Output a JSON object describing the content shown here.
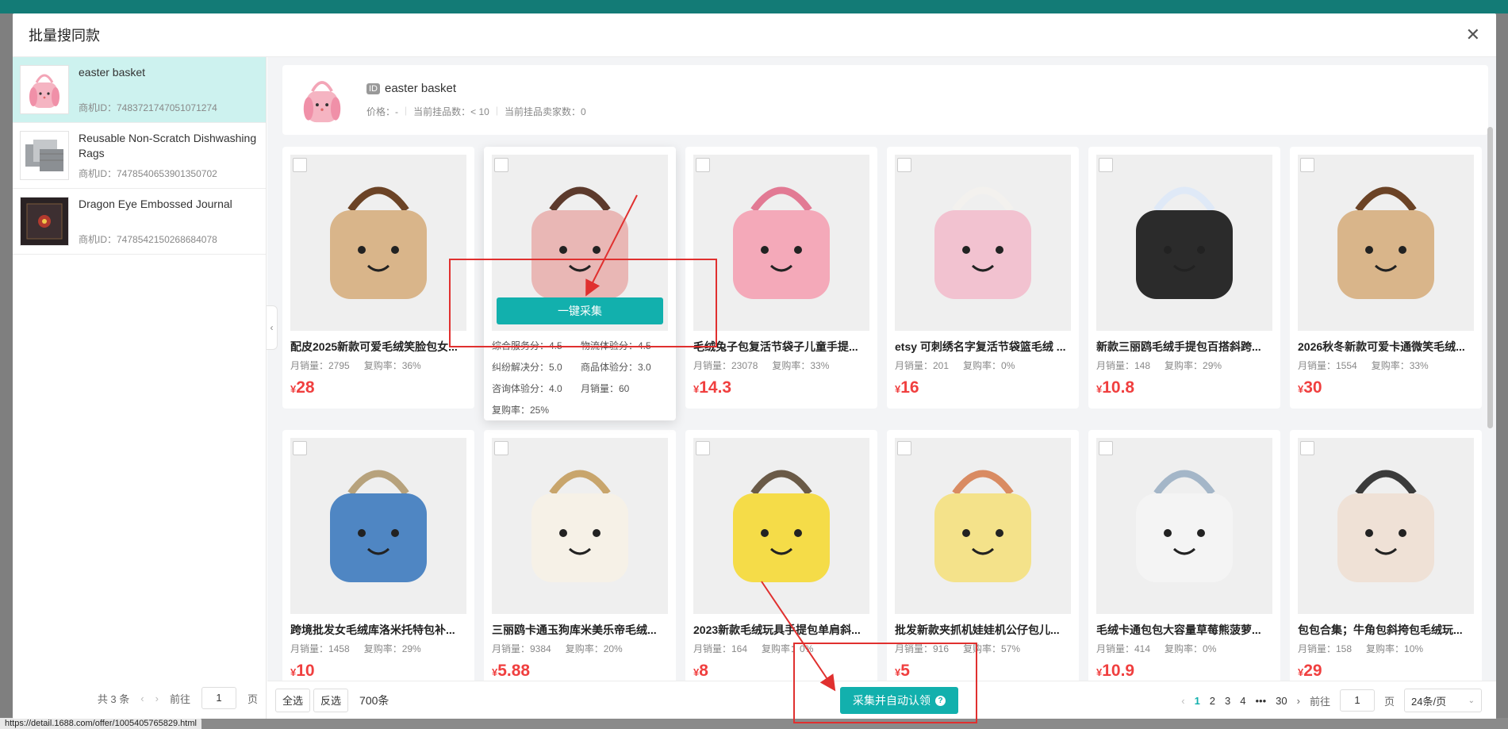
{
  "modal": {
    "title": "批量搜同款",
    "close_icon": "close-icon"
  },
  "left": {
    "items": [
      {
        "title": "easter basket",
        "id_label": "商机ID：7483721747051071274",
        "thumb": "pink-bunny-bag"
      },
      {
        "title": "Reusable Non-Scratch Dishwashing Rags",
        "id_label": "商机ID：7478540653901350702",
        "thumb": "gray-rags"
      },
      {
        "title": "Dragon Eye Embossed Journal",
        "id_label": "商机ID：7478542150268684078",
        "thumb": "dark-journal"
      }
    ],
    "pager": {
      "total": "共 3 条",
      "goto": "前往",
      "page": "1",
      "unit": "页"
    }
  },
  "header": {
    "id_tag": "ID",
    "title": "easter basket",
    "price": "价格：-",
    "listings": "当前挂品数：< 10",
    "sellers": "当前挂品卖家数：0"
  },
  "hover_card": {
    "button": "一键采集",
    "stats": [
      "综合服务分：4.5",
      "物流体验分：4.5",
      "纠纷解决分：5.0",
      "商品体验分：3.0",
      "咨询体验分：4.0",
      "月销量：60",
      "复购率：25%"
    ]
  },
  "products": [
    {
      "title": "配皮2025新款可爱毛绒笑脸包女...",
      "sales": "月销量：2795",
      "repurchase": "复购率：36%",
      "yen": "¥",
      "price": "28",
      "color": "#d9b58a",
      "accent": "#6b4326"
    },
    {
      "title": "",
      "sales": "",
      "repurchase": "",
      "yen": "",
      "price": "",
      "color": "#e9b7b5",
      "accent": "#5c3a2c"
    },
    {
      "title": "毛绒兔子包复活节袋子儿童手提...",
      "sales": "月销量：23078",
      "repurchase": "复购率：33%",
      "yen": "¥",
      "price": "14.3",
      "color": "#f4a9b9",
      "accent": "#e27a94"
    },
    {
      "title": "etsy 可刺绣名字复活节袋篮毛绒 ...",
      "sales": "月销量：201",
      "repurchase": "复购率：0%",
      "yen": "¥",
      "price": "16",
      "color": "#f2c2d0",
      "accent": "#f3f1ee"
    },
    {
      "title": "新款三丽鸥毛绒手提包百搭斜跨...",
      "sales": "月销量：148",
      "repurchase": "复购率：29%",
      "yen": "¥",
      "price": "10.8",
      "color": "#2b2b2b",
      "accent": "#dfe9f7"
    },
    {
      "title": "2026秋冬新款可爱卡通微笑毛绒...",
      "sales": "月销量：1554",
      "repurchase": "复购率：33%",
      "yen": "¥",
      "price": "30",
      "color": "#d9b58a",
      "accent": "#6b4326"
    },
    {
      "title": "跨境批发女毛绒库洛米托特包补...",
      "sales": "月销量：1458",
      "repurchase": "复购率：29%",
      "yen": "¥",
      "price": "10",
      "color": "#4f86c3",
      "accent": "#b7a27c"
    },
    {
      "title": "三丽鸥卡通玉狗库米美乐帝毛绒...",
      "sales": "月销量：9384",
      "repurchase": "复购率：20%",
      "yen": "¥",
      "price": "5.88",
      "color": "#f6f1e7",
      "accent": "#c8a56c"
    },
    {
      "title": "2023新款毛绒玩具手提包单肩斜...",
      "sales": "月销量：164",
      "repurchase": "复购率：0%",
      "yen": "¥",
      "price": "8",
      "color": "#f5dc48",
      "accent": "#6a5a47"
    },
    {
      "title": "批发新款夹抓机娃娃机公仔包儿...",
      "sales": "月销量：916",
      "repurchase": "复购率：57%",
      "yen": "¥",
      "price": "5",
      "color": "#f4e28a",
      "accent": "#d98b62"
    },
    {
      "title": "毛绒卡通包包大容量草莓熊菠萝...",
      "sales": "月销量：414",
      "repurchase": "复购率：0%",
      "yen": "¥",
      "price": "10.9",
      "color": "#f4f4f4",
      "accent": "#a4b6c8"
    },
    {
      "title": "包包合集；牛角包斜挎包毛绒玩...",
      "sales": "月销量：158",
      "repurchase": "复购率：10%",
      "yen": "¥",
      "price": "29",
      "color": "#efe1d6",
      "accent": "#3b3b3b"
    }
  ],
  "footer": {
    "select_all": "全选",
    "invert": "反选",
    "total": "700条",
    "primary": "采集并自动认领",
    "pages": [
      "1",
      "2",
      "3",
      "4",
      "•••",
      "30"
    ],
    "goto": "前往",
    "goto_value": "1",
    "unit": "页",
    "page_size": "24条/页"
  },
  "background": {
    "url": "https://detail.1688.com/offer/1005405765829.html"
  },
  "colors": {
    "accent": "#12b0ad",
    "price": "#f03f3f",
    "annotation": "#e0302f"
  }
}
